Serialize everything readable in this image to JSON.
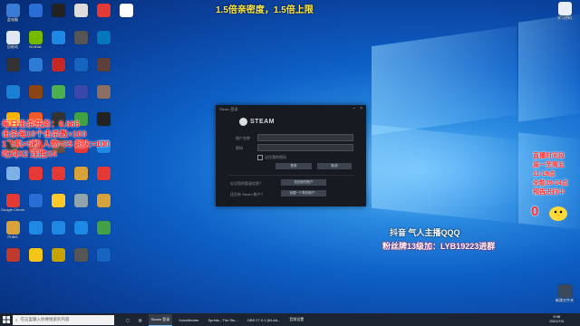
{
  "overlay": {
    "headline": "1.5倍亲密度，1.5倍上限",
    "left_lines": [
      "每日击杀任务：0.666",
      "击杀每10个击杀数+100",
      "1飞机=5秒 人物=25 超火=100",
      "吃鸡X2 连胜X4"
    ],
    "right_lines": [
      "直播时间段",
      "周一至周五",
      "11-19点",
      "全能19-24点",
      "预告进行中"
    ],
    "right_count": "0",
    "douyin_line": "抖音 气人主播QQQ",
    "fans_line": "粉丝牌13级加：LYB19223进群"
  },
  "desktop_icons": [
    {
      "label": "此电脑",
      "color": "#3a7bd5"
    },
    {
      "label": "回收站",
      "color": "#dfe8f2"
    },
    {
      "label": "",
      "color": "#333"
    },
    {
      "label": "",
      "color": "#1c7fd6"
    },
    {
      "label": "",
      "color": "#ffb300"
    },
    {
      "label": "",
      "color": "#3a3a3a"
    },
    {
      "label": "",
      "color": "#7db1e8"
    },
    {
      "label": "Google Chrome",
      "color": "#e53935"
    },
    {
      "label": "PUBG",
      "color": "#d8a23a"
    },
    {
      "label": "",
      "color": "#c0392b"
    },
    {
      "label": "",
      "color": "#2a6dd6"
    },
    {
      "label": "NVIDIA",
      "color": "#76b900"
    },
    {
      "label": "",
      "color": "#2d7bd6"
    },
    {
      "label": "",
      "color": "#8b4513"
    },
    {
      "label": "",
      "color": "#f05a28"
    },
    {
      "label": "",
      "color": "#d23c3c"
    },
    {
      "label": "",
      "color": "#e53935"
    },
    {
      "label": "",
      "color": "#2a6dd6"
    },
    {
      "label": "",
      "color": "#1e88e5"
    },
    {
      "label": "",
      "color": "#f5c518"
    },
    {
      "label": "",
      "color": "#222"
    },
    {
      "label": "",
      "color": "#1e88e5"
    },
    {
      "label": "",
      "color": "#c62828"
    },
    {
      "label": "",
      "color": "#4caf50"
    },
    {
      "label": "",
      "color": "#333"
    },
    {
      "label": "",
      "color": "#6d4c41"
    },
    {
      "label": "",
      "color": "#e53935"
    },
    {
      "label": "",
      "color": "#ffca28"
    },
    {
      "label": "",
      "color": "#1e88e5"
    },
    {
      "label": "",
      "color": "#c8a200"
    },
    {
      "label": "",
      "color": "#ddd"
    },
    {
      "label": "",
      "color": "#555"
    },
    {
      "label": "",
      "color": "#1565c0"
    },
    {
      "label": "",
      "color": "#3949ab"
    },
    {
      "label": "",
      "color": "#43a047"
    },
    {
      "label": "",
      "color": "#e53935"
    },
    {
      "label": "",
      "color": "#d8a23a"
    },
    {
      "label": "",
      "color": "#90a4ae"
    },
    {
      "label": "",
      "color": "#1e88e5"
    },
    {
      "label": "",
      "color": "#555"
    },
    {
      "label": "",
      "color": "#e53935"
    },
    {
      "label": "",
      "color": "#0277bd"
    },
    {
      "label": "",
      "color": "#5d4037"
    },
    {
      "label": "",
      "color": "#8d6e63"
    },
    {
      "label": "",
      "color": "#222"
    },
    {
      "label": "",
      "color": "#1e88e5"
    },
    {
      "label": "",
      "color": "#e53935"
    },
    {
      "label": "",
      "color": "#d8a23a"
    },
    {
      "label": "",
      "color": "#43a047"
    },
    {
      "label": "",
      "color": "#1565c0"
    },
    {
      "label": "",
      "color": "#fff"
    }
  ],
  "steam_window": {
    "title": "Steam 登录",
    "logo_text": "STEAM",
    "account_label": "账户名称",
    "password_label": "密码",
    "remember_label": "记住我的密码",
    "login_button": "登录",
    "cancel_button": "取消",
    "forgot_label": "忘记您的登录信息？",
    "forgot_button": "找回我的账户",
    "no_account_label": "还没有 Steam 帐户？",
    "create_button": "创建一个新的帐户..."
  },
  "right_desktop_icon": {
    "label": "学习资料"
  },
  "bottom_right_icon": {
    "label": "新建文件夹"
  },
  "taskbar": {
    "search_placeholder": "在这里输入你要搜索的内容",
    "apps": [
      "Steam 登录",
      "VoiceMeeter",
      "Sprints - The Stu...",
      "OBS 27.0.1 (64-bit...",
      "音频设置"
    ],
    "time": "9:38",
    "date": "2021/7/4"
  }
}
